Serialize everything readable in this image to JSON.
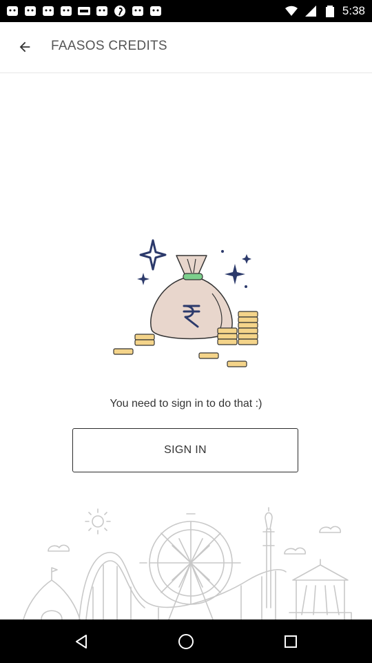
{
  "statusbar": {
    "time": "5:38",
    "notification_icons": [
      "faasos-logo-icon",
      "faasos-logo-icon",
      "faasos-logo-icon",
      "faasos-logo-icon",
      "esc-icon",
      "faasos-logo-icon",
      "pinterest-icon",
      "faasos-logo-icon",
      "faasos-logo-icon"
    ],
    "status_icons": [
      "wifi-icon",
      "signal-icon",
      "battery-icon"
    ]
  },
  "appbar": {
    "back_icon": "arrow-back-icon",
    "title": "FAASOS CREDITS"
  },
  "content": {
    "illustration": "money-bag-rupee-illustration",
    "message": "You need to sign in to do that :)",
    "signin_label": "SIGN IN",
    "footer_illustration": "carnival-illustration"
  },
  "colors": {
    "accent_navy": "#2c3a6b",
    "coin_yellow": "#f4d48a",
    "bag_fill": "#e8d6cc",
    "tag_green": "#7ccf8c"
  }
}
